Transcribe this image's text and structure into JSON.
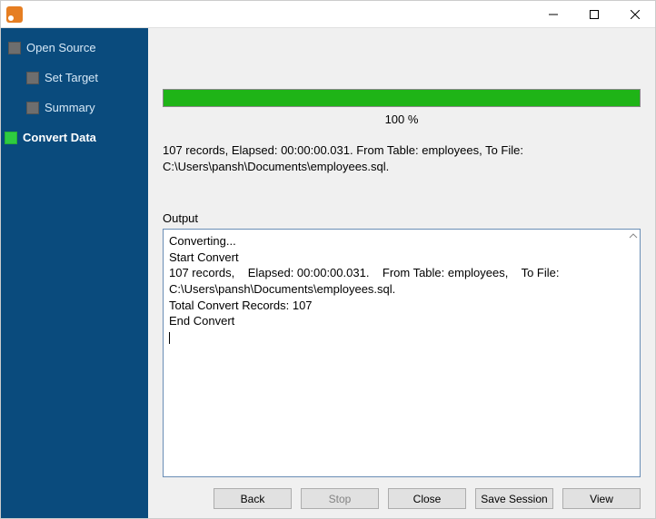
{
  "titlebar": {
    "title": ""
  },
  "sidebar": {
    "items": [
      {
        "label": "Open Source",
        "active": false,
        "indent": 0
      },
      {
        "label": "Set Target",
        "active": false,
        "indent": 1
      },
      {
        "label": "Summary",
        "active": false,
        "indent": 1
      },
      {
        "label": "Convert Data",
        "active": true,
        "indent": 0
      }
    ]
  },
  "progress": {
    "percent_label": "100 %",
    "percent_value": 100
  },
  "status": {
    "line": "107 records,    Elapsed: 00:00:00.031.    From Table: employees,    To File: C:\\Users\\pansh\\Documents\\employees.sql."
  },
  "output": {
    "label": "Output",
    "text": "Converting...\nStart Convert\n107 records,    Elapsed: 00:00:00.031.    From Table: employees,    To File: C:\\Users\\pansh\\Documents\\employees.sql.\nTotal Convert Records: 107\nEnd Convert"
  },
  "buttons": {
    "back": "Back",
    "stop": "Stop",
    "close": "Close",
    "save_session": "Save Session",
    "view": "View"
  }
}
